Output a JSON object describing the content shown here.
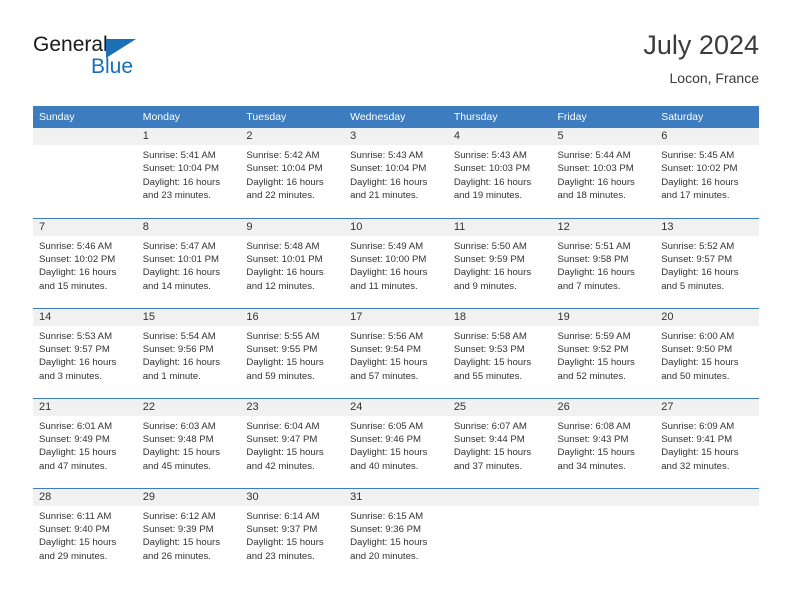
{
  "brand": {
    "name_part1": "General",
    "name_part2": "Blue",
    "accent_color": "#1a6fb5"
  },
  "header": {
    "title": "July 2024",
    "location": "Locon, France"
  },
  "theme": {
    "header_bg": "#3c7cbf",
    "daynum_bg": "#f1f1f1",
    "text_color": "#333333"
  },
  "weekdays": [
    "Sunday",
    "Monday",
    "Tuesday",
    "Wednesday",
    "Thursday",
    "Friday",
    "Saturday"
  ],
  "weeks": [
    [
      {
        "day": "",
        "empty": true,
        "sunrise": "",
        "sunset": "",
        "daylight_line1": "",
        "daylight_line2": ""
      },
      {
        "day": "1",
        "sunrise": "Sunrise: 5:41 AM",
        "sunset": "Sunset: 10:04 PM",
        "daylight_line1": "Daylight: 16 hours",
        "daylight_line2": "and 23 minutes."
      },
      {
        "day": "2",
        "sunrise": "Sunrise: 5:42 AM",
        "sunset": "Sunset: 10:04 PM",
        "daylight_line1": "Daylight: 16 hours",
        "daylight_line2": "and 22 minutes."
      },
      {
        "day": "3",
        "sunrise": "Sunrise: 5:43 AM",
        "sunset": "Sunset: 10:04 PM",
        "daylight_line1": "Daylight: 16 hours",
        "daylight_line2": "and 21 minutes."
      },
      {
        "day": "4",
        "sunrise": "Sunrise: 5:43 AM",
        "sunset": "Sunset: 10:03 PM",
        "daylight_line1": "Daylight: 16 hours",
        "daylight_line2": "and 19 minutes."
      },
      {
        "day": "5",
        "sunrise": "Sunrise: 5:44 AM",
        "sunset": "Sunset: 10:03 PM",
        "daylight_line1": "Daylight: 16 hours",
        "daylight_line2": "and 18 minutes."
      },
      {
        "day": "6",
        "sunrise": "Sunrise: 5:45 AM",
        "sunset": "Sunset: 10:02 PM",
        "daylight_line1": "Daylight: 16 hours",
        "daylight_line2": "and 17 minutes."
      }
    ],
    [
      {
        "day": "7",
        "sunrise": "Sunrise: 5:46 AM",
        "sunset": "Sunset: 10:02 PM",
        "daylight_line1": "Daylight: 16 hours",
        "daylight_line2": "and 15 minutes."
      },
      {
        "day": "8",
        "sunrise": "Sunrise: 5:47 AM",
        "sunset": "Sunset: 10:01 PM",
        "daylight_line1": "Daylight: 16 hours",
        "daylight_line2": "and 14 minutes."
      },
      {
        "day": "9",
        "sunrise": "Sunrise: 5:48 AM",
        "sunset": "Sunset: 10:01 PM",
        "daylight_line1": "Daylight: 16 hours",
        "daylight_line2": "and 12 minutes."
      },
      {
        "day": "10",
        "sunrise": "Sunrise: 5:49 AM",
        "sunset": "Sunset: 10:00 PM",
        "daylight_line1": "Daylight: 16 hours",
        "daylight_line2": "and 11 minutes."
      },
      {
        "day": "11",
        "sunrise": "Sunrise: 5:50 AM",
        "sunset": "Sunset: 9:59 PM",
        "daylight_line1": "Daylight: 16 hours",
        "daylight_line2": "and 9 minutes."
      },
      {
        "day": "12",
        "sunrise": "Sunrise: 5:51 AM",
        "sunset": "Sunset: 9:58 PM",
        "daylight_line1": "Daylight: 16 hours",
        "daylight_line2": "and 7 minutes."
      },
      {
        "day": "13",
        "sunrise": "Sunrise: 5:52 AM",
        "sunset": "Sunset: 9:57 PM",
        "daylight_line1": "Daylight: 16 hours",
        "daylight_line2": "and 5 minutes."
      }
    ],
    [
      {
        "day": "14",
        "sunrise": "Sunrise: 5:53 AM",
        "sunset": "Sunset: 9:57 PM",
        "daylight_line1": "Daylight: 16 hours",
        "daylight_line2": "and 3 minutes."
      },
      {
        "day": "15",
        "sunrise": "Sunrise: 5:54 AM",
        "sunset": "Sunset: 9:56 PM",
        "daylight_line1": "Daylight: 16 hours",
        "daylight_line2": "and 1 minute."
      },
      {
        "day": "16",
        "sunrise": "Sunrise: 5:55 AM",
        "sunset": "Sunset: 9:55 PM",
        "daylight_line1": "Daylight: 15 hours",
        "daylight_line2": "and 59 minutes."
      },
      {
        "day": "17",
        "sunrise": "Sunrise: 5:56 AM",
        "sunset": "Sunset: 9:54 PM",
        "daylight_line1": "Daylight: 15 hours",
        "daylight_line2": "and 57 minutes."
      },
      {
        "day": "18",
        "sunrise": "Sunrise: 5:58 AM",
        "sunset": "Sunset: 9:53 PM",
        "daylight_line1": "Daylight: 15 hours",
        "daylight_line2": "and 55 minutes."
      },
      {
        "day": "19",
        "sunrise": "Sunrise: 5:59 AM",
        "sunset": "Sunset: 9:52 PM",
        "daylight_line1": "Daylight: 15 hours",
        "daylight_line2": "and 52 minutes."
      },
      {
        "day": "20",
        "sunrise": "Sunrise: 6:00 AM",
        "sunset": "Sunset: 9:50 PM",
        "daylight_line1": "Daylight: 15 hours",
        "daylight_line2": "and 50 minutes."
      }
    ],
    [
      {
        "day": "21",
        "sunrise": "Sunrise: 6:01 AM",
        "sunset": "Sunset: 9:49 PM",
        "daylight_line1": "Daylight: 15 hours",
        "daylight_line2": "and 47 minutes."
      },
      {
        "day": "22",
        "sunrise": "Sunrise: 6:03 AM",
        "sunset": "Sunset: 9:48 PM",
        "daylight_line1": "Daylight: 15 hours",
        "daylight_line2": "and 45 minutes."
      },
      {
        "day": "23",
        "sunrise": "Sunrise: 6:04 AM",
        "sunset": "Sunset: 9:47 PM",
        "daylight_line1": "Daylight: 15 hours",
        "daylight_line2": "and 42 minutes."
      },
      {
        "day": "24",
        "sunrise": "Sunrise: 6:05 AM",
        "sunset": "Sunset: 9:46 PM",
        "daylight_line1": "Daylight: 15 hours",
        "daylight_line2": "and 40 minutes."
      },
      {
        "day": "25",
        "sunrise": "Sunrise: 6:07 AM",
        "sunset": "Sunset: 9:44 PM",
        "daylight_line1": "Daylight: 15 hours",
        "daylight_line2": "and 37 minutes."
      },
      {
        "day": "26",
        "sunrise": "Sunrise: 6:08 AM",
        "sunset": "Sunset: 9:43 PM",
        "daylight_line1": "Daylight: 15 hours",
        "daylight_line2": "and 34 minutes."
      },
      {
        "day": "27",
        "sunrise": "Sunrise: 6:09 AM",
        "sunset": "Sunset: 9:41 PM",
        "daylight_line1": "Daylight: 15 hours",
        "daylight_line2": "and 32 minutes."
      }
    ],
    [
      {
        "day": "28",
        "sunrise": "Sunrise: 6:11 AM",
        "sunset": "Sunset: 9:40 PM",
        "daylight_line1": "Daylight: 15 hours",
        "daylight_line2": "and 29 minutes."
      },
      {
        "day": "29",
        "sunrise": "Sunrise: 6:12 AM",
        "sunset": "Sunset: 9:39 PM",
        "daylight_line1": "Daylight: 15 hours",
        "daylight_line2": "and 26 minutes."
      },
      {
        "day": "30",
        "sunrise": "Sunrise: 6:14 AM",
        "sunset": "Sunset: 9:37 PM",
        "daylight_line1": "Daylight: 15 hours",
        "daylight_line2": "and 23 minutes."
      },
      {
        "day": "31",
        "sunrise": "Sunrise: 6:15 AM",
        "sunset": "Sunset: 9:36 PM",
        "daylight_line1": "Daylight: 15 hours",
        "daylight_line2": "and 20 minutes."
      },
      {
        "day": "",
        "empty": true,
        "sunrise": "",
        "sunset": "",
        "daylight_line1": "",
        "daylight_line2": ""
      },
      {
        "day": "",
        "empty": true,
        "sunrise": "",
        "sunset": "",
        "daylight_line1": "",
        "daylight_line2": ""
      },
      {
        "day": "",
        "empty": true,
        "sunrise": "",
        "sunset": "",
        "daylight_line1": "",
        "daylight_line2": ""
      }
    ]
  ]
}
